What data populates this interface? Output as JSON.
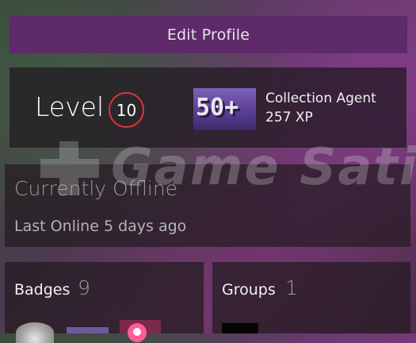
{
  "edit_profile": {
    "label": "Edit Profile"
  },
  "level": {
    "label": "Level",
    "value": "10",
    "ring_color": "#d9343d"
  },
  "featured_badge": {
    "icon_text": "50+",
    "name": "Collection Agent",
    "xp": "257 XP"
  },
  "status": {
    "state": "Currently Offline",
    "last_online": "Last Online 5 days ago"
  },
  "watermark": {
    "text": "Game Satis"
  },
  "badges": {
    "label": "Badges",
    "count": "9"
  },
  "groups": {
    "label": "Groups",
    "count": "1"
  },
  "colors": {
    "edit_button": "#5e2a6a",
    "level_ring": "#d9343d"
  }
}
